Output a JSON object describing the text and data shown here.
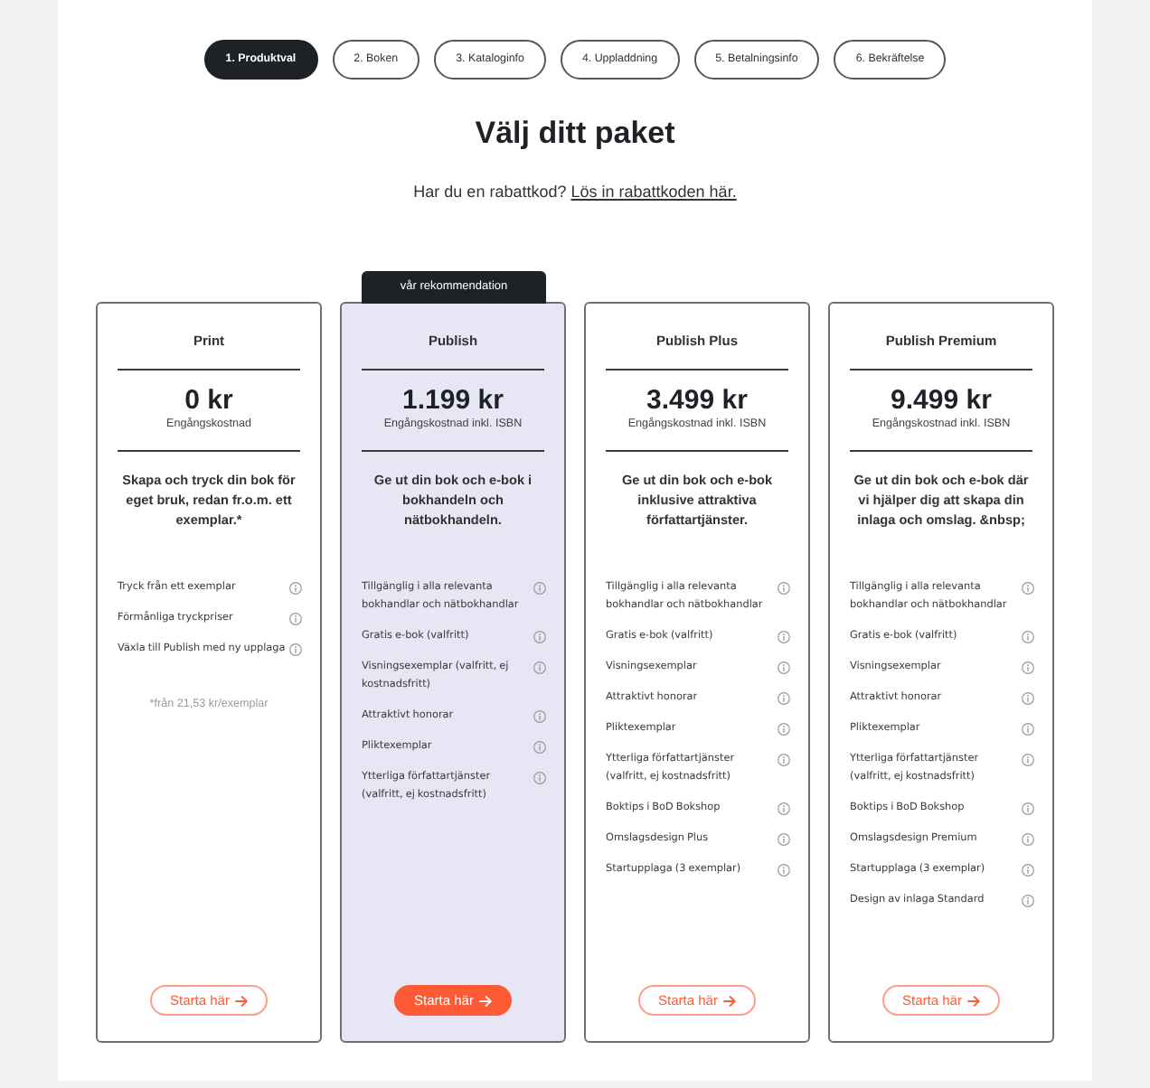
{
  "steps": [
    {
      "label": "1. Produktval",
      "selected": true
    },
    {
      "label": "2. Boken",
      "selected": false
    },
    {
      "label": "3. Kataloginfo",
      "selected": false
    },
    {
      "label": "4. Uppladdning",
      "selected": false
    },
    {
      "label": "5. Betalningsinfo",
      "selected": false
    },
    {
      "label": "6. Bekräftelse",
      "selected": false
    }
  ],
  "heading": "Välj ditt paket",
  "discount": {
    "question": "Har du en rabattkod?",
    "link": "Lös in rabattkoden här."
  },
  "plans": [
    {
      "name": "Print",
      "price": "0 kr",
      "price_note": "Engångskostnad",
      "description": "Skapa och tryck din bok för eget bruk, redan fr.o.m. ett exemplar.*",
      "features": [
        "Tryck från ett exemplar",
        "Förmånliga tryckpriser",
        "Växla till Publish med ny upplaga"
      ],
      "footnote": "*från 21,53 kr/exemplar",
      "recommended": false,
      "button": "Starta här"
    },
    {
      "name": "Publish",
      "badge": "vår rekommendation",
      "price": "1.199 kr",
      "price_note": "Engångskostnad inkl. ISBN",
      "description": "Ge ut din bok och e-bok i bokhandeln och nätbokhandeln.",
      "features": [
        "Tillgänglig i alla relevanta bokhandlar och nätbokhandlar",
        "Gratis e-bok (valfritt)",
        "Visningsexemplar (valfritt, ej kostnadsfritt)",
        "Attraktivt honorar",
        "Pliktexemplar",
        "Ytterliga författartjänster (valfritt, ej kostnadsfritt)"
      ],
      "recommended": true,
      "button": "Starta här"
    },
    {
      "name": "Publish Plus",
      "price": "3.499 kr",
      "price_note": "Engångskostnad inkl. ISBN",
      "description": "Ge ut din bok och e-bok inklusive attraktiva författartjänster.",
      "features": [
        "Tillgänglig i alla relevanta bokhandlar och nätbokhandlar",
        "Gratis e-bok (valfritt)",
        "Visningsexemplar",
        "Attraktivt honorar",
        "Pliktexemplar",
        "Ytterliga författartjänster (valfritt, ej kostnadsfritt)",
        "Boktips i BoD Bokshop",
        "Omslagsdesign Plus",
        "Startupplaga (3 exemplar)"
      ],
      "recommended": false,
      "button": "Starta här"
    },
    {
      "name": "Publish Premium",
      "price": "9.499 kr",
      "price_note": "Engångskostnad inkl. ISBN",
      "description": "Ge ut din bok och e-bok där vi hjälper dig att skapa din inlaga och omslag. &nbsp;",
      "features": [
        "Tillgänglig i alla relevanta bokhandlar och nätbokhandlar",
        "Gratis e-bok (valfritt)",
        "Visningsexemplar",
        "Attraktivt honorar",
        "Pliktexemplar",
        "Ytterliga författartjänster (valfritt, ej kostnadsfritt)",
        "Boktips i BoD Bokshop",
        "Omslagsdesign Premium",
        "Startupplaga (3 exemplar)",
        "Design av inlaga Standard"
      ],
      "recommended": false,
      "button": "Starta här"
    }
  ]
}
